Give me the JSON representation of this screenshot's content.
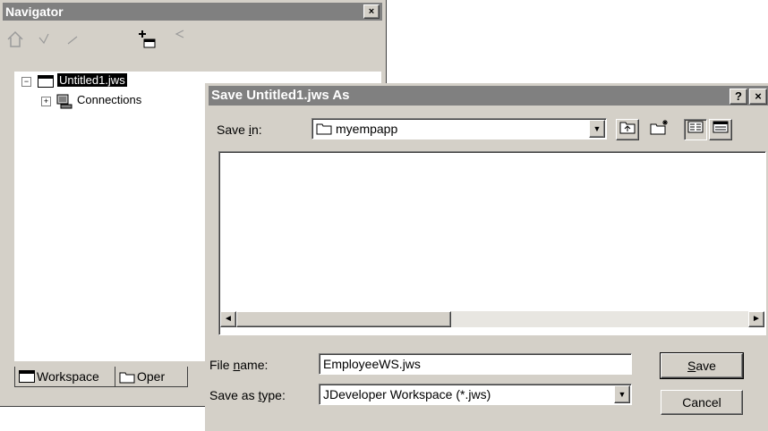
{
  "navigator": {
    "title": "Navigator",
    "close_glyph": "×",
    "toolbar_icons": [
      "home-icon",
      "back-icon",
      "forward-icon",
      "add-icon",
      "collapse-icon"
    ],
    "tree": {
      "root_label": "Untitled1.jws",
      "child_label": "Connections",
      "expander_minus": "−",
      "expander_plus": "+"
    },
    "tabs": [
      "Workspace",
      "Oper"
    ]
  },
  "dialog": {
    "title": "Save Untitled1.jws As",
    "help_glyph": "?",
    "close_glyph": "×",
    "save_in_label_pre": "Save ",
    "save_in_label_accel": "i",
    "save_in_label_post": "n:",
    "save_in_value": "myempapp",
    "file_name_label_pre": "File ",
    "file_name_label_accel": "n",
    "file_name_label_post": "ame:",
    "file_name_value": "EmployeeWS.jws",
    "save_as_type_label_pre": "Save as ",
    "save_as_type_label_accel": "t",
    "save_as_type_label_post": "ype:",
    "save_as_type_value": "JDeveloper Workspace (*.jws)",
    "save_button_accel": "S",
    "save_button_rest": "ave",
    "cancel_button": "Cancel",
    "arrow_down": "▼",
    "arrow_left": "◄",
    "arrow_right": "►"
  }
}
